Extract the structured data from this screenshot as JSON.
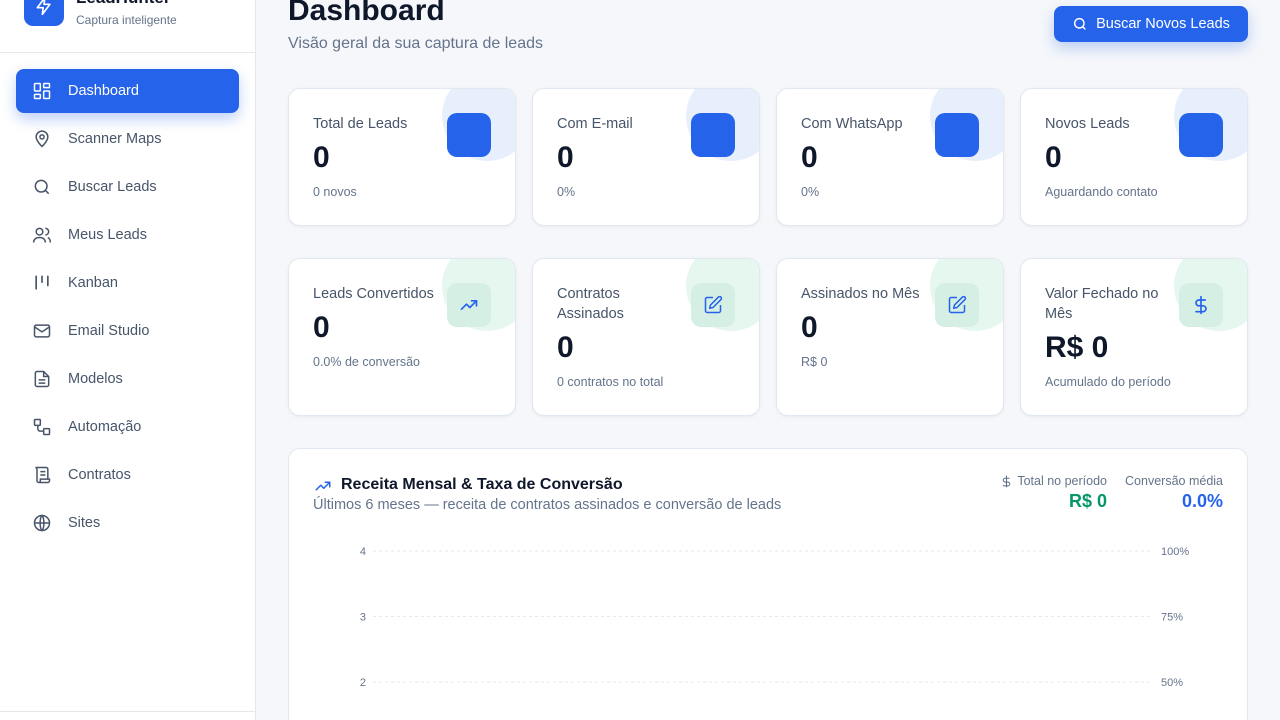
{
  "brand": {
    "name": "LeadHunter",
    "subtitle": "Captura inteligente"
  },
  "nav": [
    {
      "label": "Dashboard",
      "icon": "grid-icon",
      "active": true
    },
    {
      "label": "Scanner Maps",
      "icon": "map-pin-icon"
    },
    {
      "label": "Buscar Leads",
      "icon": "search-icon"
    },
    {
      "label": "Meus Leads",
      "icon": "users-icon"
    },
    {
      "label": "Kanban",
      "icon": "kanban-icon"
    },
    {
      "label": "Email Studio",
      "icon": "mail-icon"
    },
    {
      "label": "Modelos",
      "icon": "file-icon"
    },
    {
      "label": "Automação",
      "icon": "workflow-icon"
    },
    {
      "label": "Contratos",
      "icon": "scroll-icon"
    },
    {
      "label": "Sites",
      "icon": "globe-icon"
    }
  ],
  "header": {
    "title": "Dashboard",
    "subtitle": "Visão geral da sua captura de leads",
    "action_label": "Buscar Novos Leads"
  },
  "stats_row1": [
    {
      "label": "Total de Leads",
      "value": "0",
      "note": "0 novos"
    },
    {
      "label": "Com E-mail",
      "value": "0",
      "note": "0%"
    },
    {
      "label": "Com WhatsApp",
      "value": "0",
      "note": "0%"
    },
    {
      "label": "Novos Leads",
      "value": "0",
      "note": "Aguardando contato"
    }
  ],
  "stats_row2": [
    {
      "label": "Leads Convertidos",
      "value": "0",
      "note": "0.0% de conversão",
      "icon": "trending-up-icon"
    },
    {
      "label": "Contratos Assinados",
      "value": "0",
      "note": "0 contratos no total",
      "icon": "signature-icon"
    },
    {
      "label": "Assinados no Mês",
      "value": "0",
      "note": "R$ 0",
      "icon": "signature-icon"
    },
    {
      "label": "Valor Fechado no Mês",
      "value": "R$ 0",
      "note": "Acumulado do período",
      "icon": "dollar-icon"
    }
  ],
  "chart_panel": {
    "title": "Receita Mensal & Taxa de Conversão",
    "subtitle": "Últimos 6 meses — receita de contratos assinados e conversão de leads",
    "total_label": "Total no período",
    "total_value": "R$ 0",
    "conversion_label": "Conversão média",
    "conversion_value": "0.0%"
  },
  "chart_data": {
    "type": "line",
    "title": "Receita Mensal & Taxa de Conversão",
    "y_left_ticks": [
      "4",
      "3",
      "2"
    ],
    "y_right_ticks": [
      "100%",
      "75%",
      "50%"
    ],
    "grid": true
  },
  "colors": {
    "primary": "#2563eb",
    "green": "#059669",
    "text_dark": "#0f172a",
    "text_muted": "#64748b"
  }
}
